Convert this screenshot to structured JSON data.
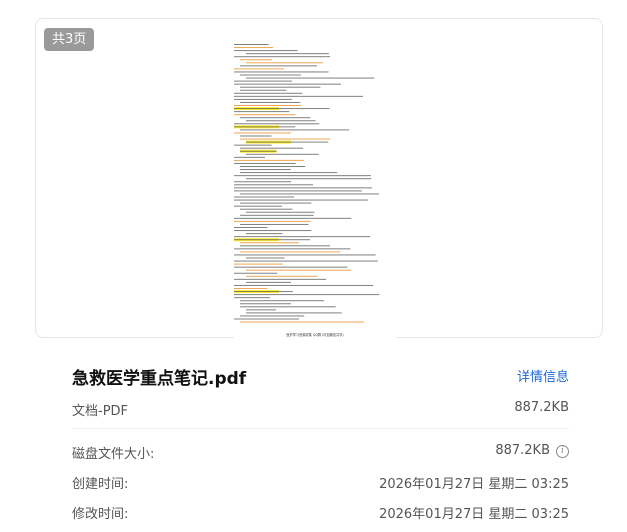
{
  "preview": {
    "page_count_badge": "共3页",
    "footer_text": "医护学习资源收集 QQ群  (可加微信共享)"
  },
  "file": {
    "name": "急救医学重点笔记.pdf",
    "details_link": "详情信息",
    "type": "文档-PDF",
    "size": "887.2KB"
  },
  "info_rows": {
    "disk_size_label": "磁盘文件大小:",
    "disk_size_value": "887.2KB",
    "created_label": "创建时间:",
    "created_value": "2026年01月27日 星期二 03:25",
    "modified_label": "修改时间:",
    "modified_value": "2026年01月27日 星期二 03:25"
  },
  "colors": {
    "badge": "#9a9a9a",
    "link": "#1a66d9",
    "highlight": "#ffee33",
    "orange_text": "#e8871e"
  },
  "icons": {
    "info": "info-circle-icon"
  }
}
